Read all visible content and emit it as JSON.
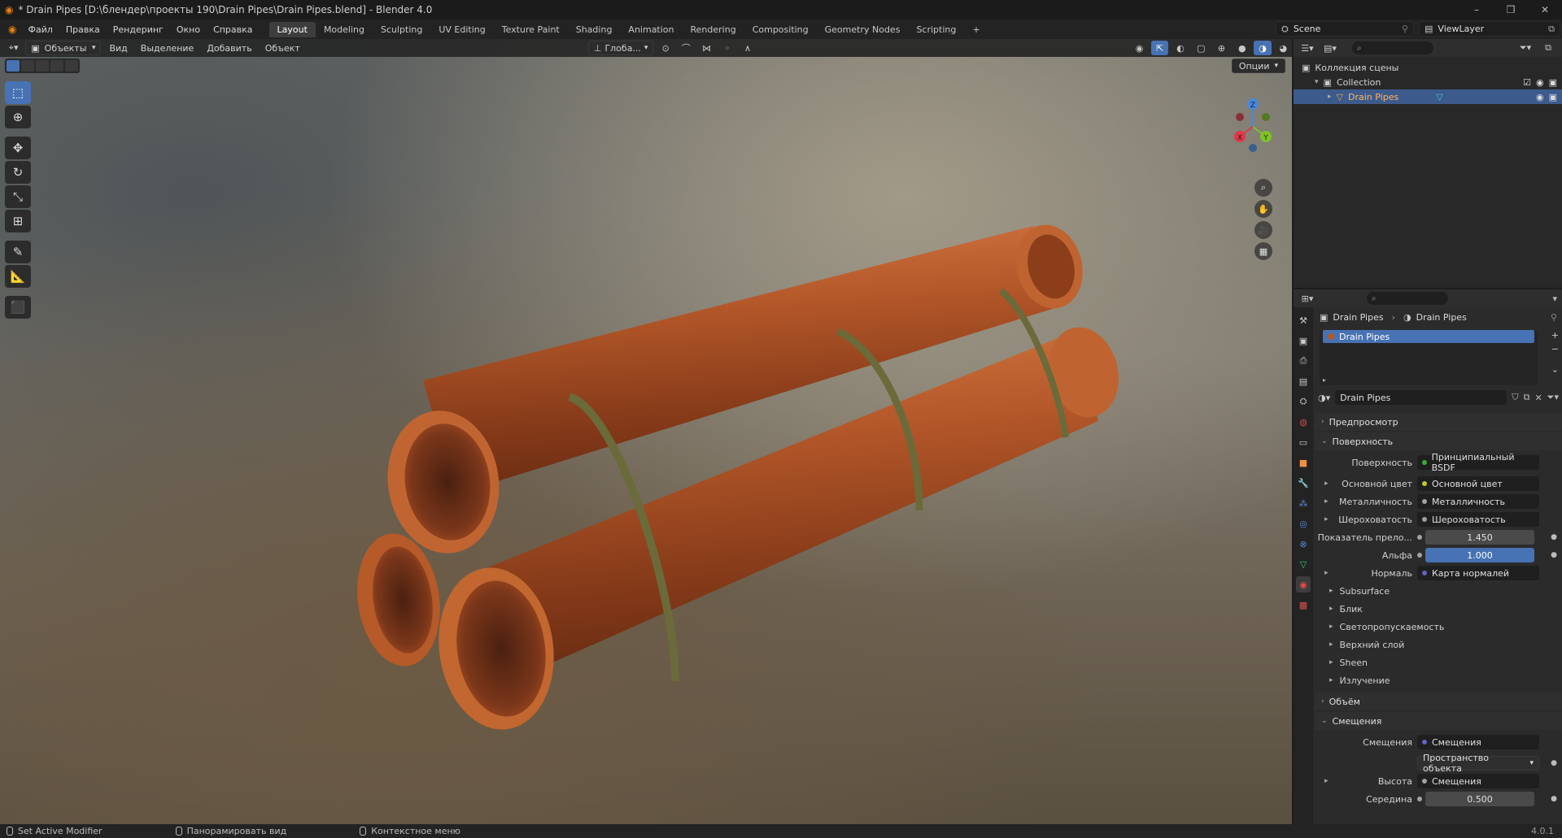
{
  "window": {
    "title": "* Drain Pipes [D:\\блендер\\проекты 190\\Drain Pipes\\Drain Pipes.blend] - Blender 4.0",
    "controls": [
      "–",
      "❐",
      "✕"
    ]
  },
  "menubar": {
    "menus": [
      "Файл",
      "Правка",
      "Рендеринг",
      "Окно",
      "Справка"
    ],
    "workspaces": [
      "Layout",
      "Modeling",
      "Sculpting",
      "UV Editing",
      "Texture Paint",
      "Shading",
      "Animation",
      "Rendering",
      "Compositing",
      "Geometry Nodes",
      "Scripting"
    ],
    "active_workspace": "Layout",
    "add_tab": "+",
    "scene": "Scene",
    "view_layer": "ViewLayer"
  },
  "viewport": {
    "mode": "Объекты",
    "menus": [
      "Вид",
      "Выделение",
      "Добавить",
      "Объект"
    ],
    "orientation": "Глоба...",
    "options": "Опции",
    "gizmo_axes": [
      "X",
      "Y",
      "Z"
    ],
    "pipe_color": "#b5582a",
    "strap_color": "#6b6a3a"
  },
  "outliner": {
    "search_placeholder": "",
    "rows": [
      {
        "label": "Коллекция сцены"
      },
      {
        "label": "Collection"
      },
      {
        "label": "Drain Pipes"
      }
    ]
  },
  "properties": {
    "breadcrumb": [
      "Drain Pipes",
      "Drain Pipes"
    ],
    "material_slot": "Drain Pipes",
    "material_name": "Drain Pipes",
    "panels": {
      "preview": "Предпросмотр",
      "surface": "Поверхность",
      "volume": "Объём",
      "displacement": "Смещения"
    },
    "surface_rows": [
      {
        "label": "Поверхность",
        "value": "Принципиальный BSDF",
        "dot": "#3ca83c"
      },
      {
        "label": "Основной цвет",
        "value": "Основной цвет",
        "dot": "#c7c729"
      },
      {
        "label": "Металличность",
        "value": "Металличность",
        "dot": "#a1a1a1"
      },
      {
        "label": "Шероховатость",
        "value": "Шероховатость",
        "dot": "#a1a1a1"
      }
    ],
    "ior": {
      "label": "Показатель прело...",
      "value": "1.450"
    },
    "alpha": {
      "label": "Альфа",
      "value": "1.000"
    },
    "normal": {
      "label": "Нормаль",
      "value": "Карта нормалей",
      "dot": "#6363c7"
    },
    "subpanels": [
      "Subsurface",
      "Блик",
      "Светопропускаемость",
      "Верхний слой",
      "Sheen",
      "Излучение"
    ],
    "displacement_rows": {
      "disp": {
        "label": "Смещения",
        "value": "Смещения",
        "dot": "#6363c7"
      },
      "space": "Пространство объекта",
      "height": {
        "label": "Высота",
        "value": "Смещения",
        "dot": "#a1a1a1"
      },
      "midlevel": {
        "label": "Середина",
        "value": "0.500"
      }
    }
  },
  "statusbar": {
    "items": [
      "Set Active Modifier",
      "Панорамировать вид",
      "Контекстное меню"
    ],
    "version": "4.0.1"
  }
}
